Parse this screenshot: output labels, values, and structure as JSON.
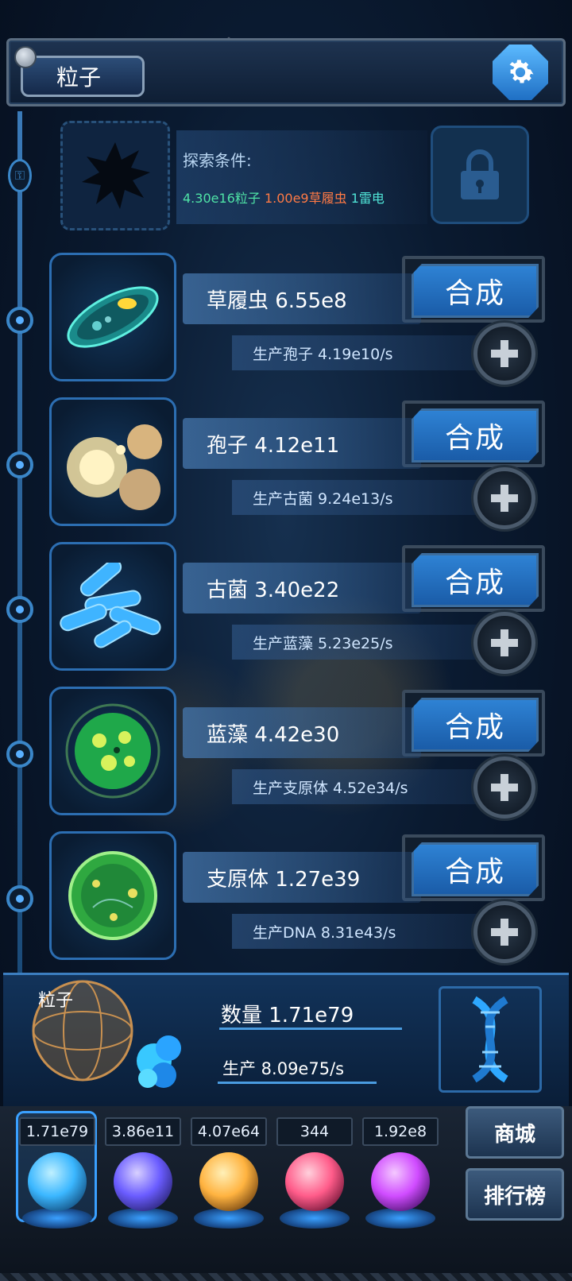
{
  "header": {
    "title": "粒子"
  },
  "explore": {
    "label": "探索条件:",
    "cond_particles": "4.30e16粒子",
    "cond_paramecium": "1.00e9草履虫",
    "cond_thunder": "1雷电"
  },
  "rows": [
    {
      "name": "草履虫 6.55e8",
      "production": "生产孢子 4.19e10/s",
      "button": "合成",
      "icon": "paramecium-icon"
    },
    {
      "name": "孢子 4.12e11",
      "production": "生产古菌 9.24e13/s",
      "button": "合成",
      "icon": "spore-icon"
    },
    {
      "name": "古菌 3.40e22",
      "production": "生产蓝藻 5.23e25/s",
      "button": "合成",
      "icon": "archaea-icon"
    },
    {
      "name": "蓝藻 4.42e30",
      "production": "生产支原体 4.52e34/s",
      "button": "合成",
      "icon": "cyanobacteria-icon"
    },
    {
      "name": "支原体 1.27e39",
      "production": "生产DNA 8.31e43/s",
      "button": "合成",
      "icon": "mycoplasma-icon"
    }
  ],
  "summary": {
    "label": "粒子",
    "count": "数量 1.71e79",
    "production": "生产 8.09e75/s"
  },
  "resources": [
    {
      "value": "1.71e79",
      "icon": "particle-orb-icon",
      "color": "#3bb7ff"
    },
    {
      "value": "3.86e11",
      "icon": "lightning-orb-icon",
      "color": "#6a5cff"
    },
    {
      "value": "4.07e64",
      "icon": "fire-orb-icon",
      "color": "#ffb340"
    },
    {
      "value": "344",
      "icon": "brain-orb-icon",
      "color": "#ff5c8a"
    },
    {
      "value": "1.92e8",
      "icon": "vortex-orb-icon",
      "color": "#d04cff"
    }
  ],
  "side_buttons": {
    "shop": "商城",
    "rank": "排行榜"
  },
  "colors": {
    "accent": "#2e82d4",
    "green": "#4fe3a6",
    "orange": "#ff7a45"
  }
}
